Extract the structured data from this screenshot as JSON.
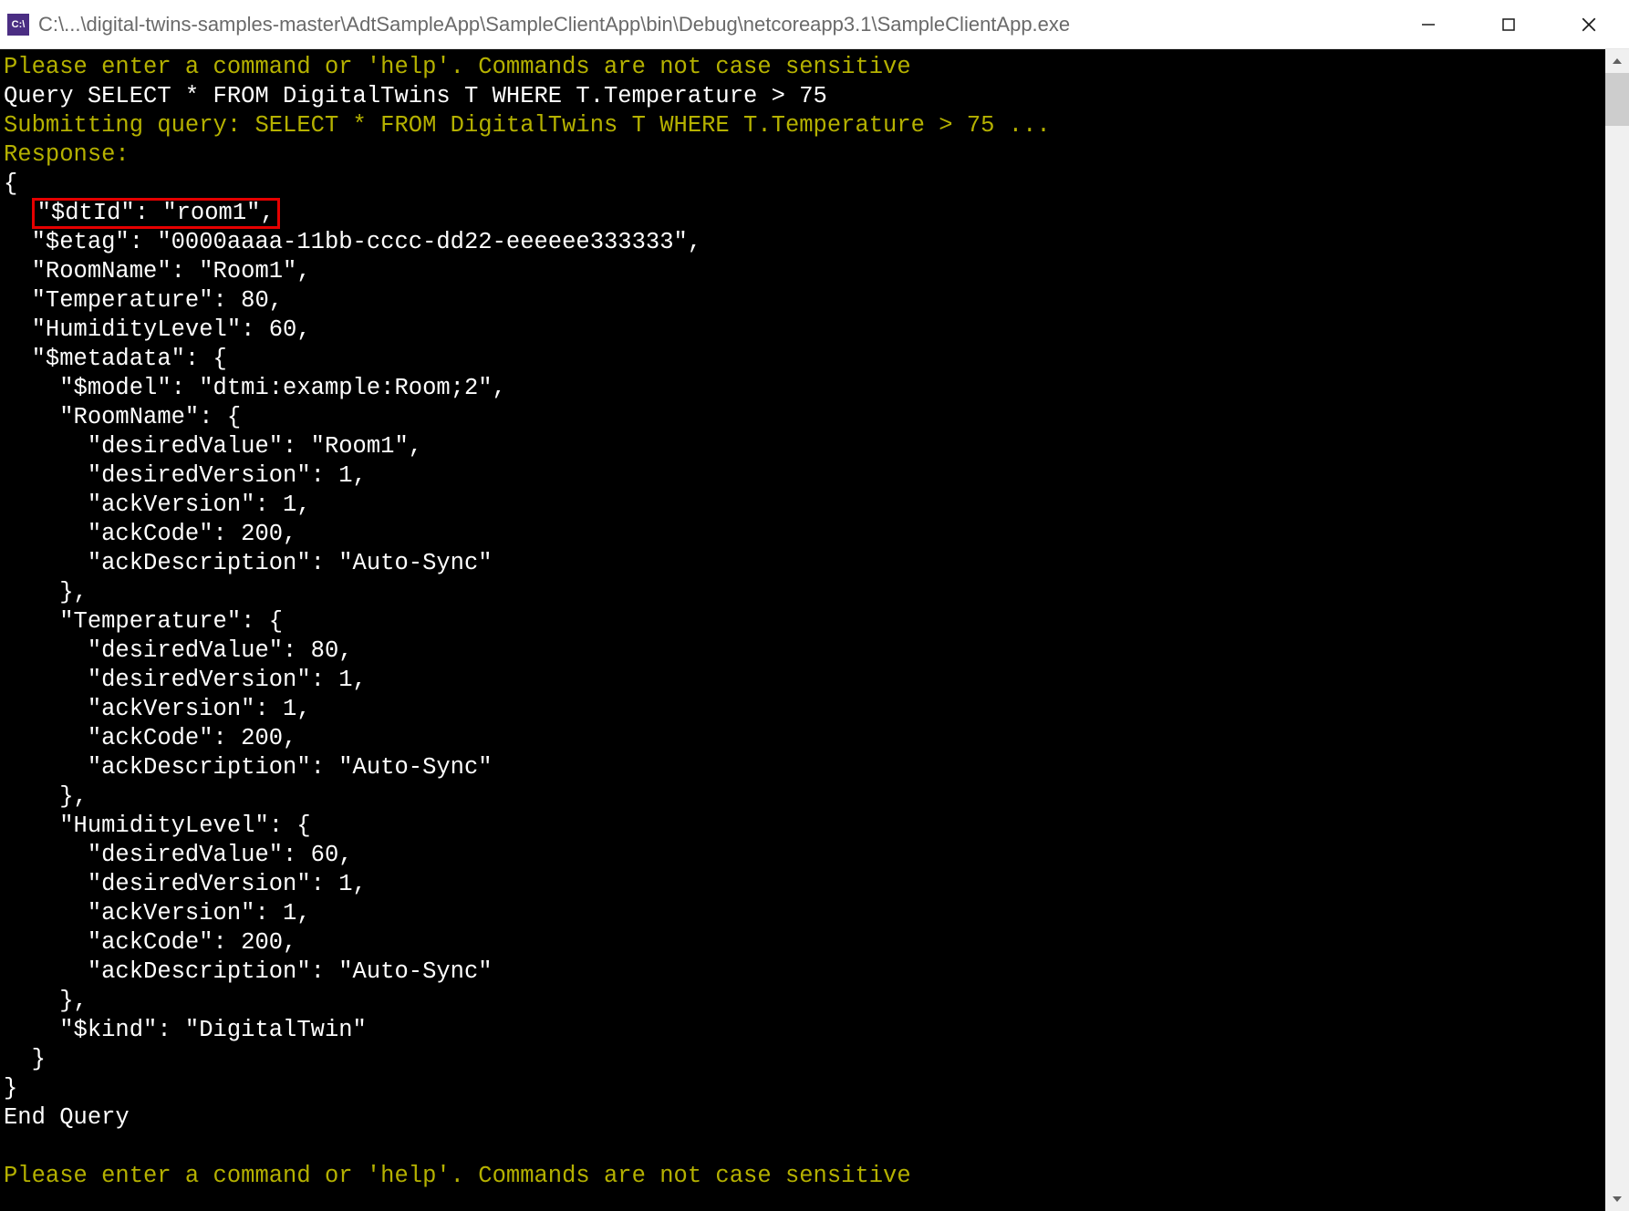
{
  "window": {
    "icon_label": "C:\\",
    "title": "C:\\...\\digital-twins-samples-master\\AdtSampleApp\\SampleClientApp\\bin\\Debug\\netcoreapp3.1\\SampleClientApp.exe"
  },
  "console": {
    "prompt1": "Please enter a command or 'help'. Commands are not case sensitive",
    "query_line": "Query SELECT * FROM DigitalTwins T WHERE T.Temperature > 75",
    "submitting": "Submitting query: SELECT * FROM DigitalTwins T WHERE T.Temperature > 75 ...",
    "response_label": "Response:",
    "open_brace": "{",
    "dtid_line": "\"$dtId\": \"room1\",",
    "etag_line": "  \"$etag\": \"0000aaaa-11bb-cccc-dd22-eeeeee333333\",",
    "roomname_line": "  \"RoomName\": \"Room1\",",
    "temperature_line": "  \"Temperature\": 80,",
    "humidity_line": "  \"HumidityLevel\": 60,",
    "metadata_open": "  \"$metadata\": {",
    "model_line": "    \"$model\": \"dtmi:example:Room;2\",",
    "meta_roomname_open": "    \"RoomName\": {",
    "rn_desired_value": "      \"desiredValue\": \"Room1\",",
    "rn_desired_version": "      \"desiredVersion\": 1,",
    "rn_ack_version": "      \"ackVersion\": 1,",
    "rn_ack_code": "      \"ackCode\": 200,",
    "rn_ack_desc": "      \"ackDescription\": \"Auto-Sync\"",
    "rn_close": "    },",
    "meta_temp_open": "    \"Temperature\": {",
    "t_desired_value": "      \"desiredValue\": 80,",
    "t_desired_version": "      \"desiredVersion\": 1,",
    "t_ack_version": "      \"ackVersion\": 1,",
    "t_ack_code": "      \"ackCode\": 200,",
    "t_ack_desc": "      \"ackDescription\": \"Auto-Sync\"",
    "t_close": "    },",
    "meta_hum_open": "    \"HumidityLevel\": {",
    "h_desired_value": "      \"desiredValue\": 60,",
    "h_desired_version": "      \"desiredVersion\": 1,",
    "h_ack_version": "      \"ackVersion\": 1,",
    "h_ack_code": "      \"ackCode\": 200,",
    "h_ack_desc": "      \"ackDescription\": \"Auto-Sync\"",
    "h_close": "    },",
    "kind_line": "    \"$kind\": \"DigitalTwin\"",
    "metadata_close": "  }",
    "close_brace": "}",
    "end_query": "End Query",
    "prompt2": "Please enter a command or 'help'. Commands are not case sensitive"
  }
}
